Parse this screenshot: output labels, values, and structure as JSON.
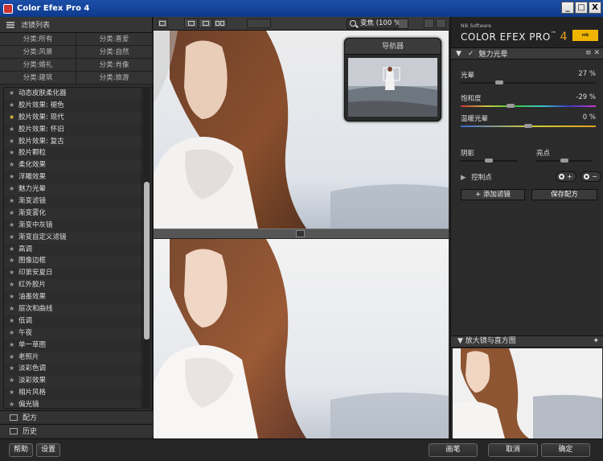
{
  "window": {
    "title": "Color Efex Pro 4",
    "minimize_glyph": "_",
    "maximize_glyph": "□",
    "close_glyph": "X"
  },
  "left_panel": {
    "header": "滤镜列表",
    "categories": [
      "分类:所有",
      "分类:喜爱",
      "分类:风景",
      "分类:自然",
      "分类:婚礼",
      "分类:肖像",
      "分类:建筑",
      "分类:旅游"
    ],
    "filters": [
      {
        "label": "动态皮肤柔化器",
        "favorite": false
      },
      {
        "label": "胶片效果: 褪色",
        "favorite": false
      },
      {
        "label": "胶片效果: 现代",
        "favorite": true
      },
      {
        "label": "胶片效果: 怀旧",
        "favorite": false
      },
      {
        "label": "胶片效果: 复古",
        "favorite": false
      },
      {
        "label": "胶片颗粒",
        "favorite": false
      },
      {
        "label": "柔化效果",
        "favorite": false
      },
      {
        "label": "浮雕效果",
        "favorite": false
      },
      {
        "label": "魅力光晕",
        "favorite": false
      },
      {
        "label": "渐变滤镜",
        "favorite": false
      },
      {
        "label": "渐变雾化",
        "favorite": false
      },
      {
        "label": "渐变中灰镜",
        "favorite": false
      },
      {
        "label": "渐变自定义滤镜",
        "favorite": false
      },
      {
        "label": "高调",
        "favorite": false
      },
      {
        "label": "图像边框",
        "favorite": false
      },
      {
        "label": "印第安夏日",
        "favorite": false
      },
      {
        "label": "红外胶片",
        "favorite": false
      },
      {
        "label": "油墨效果",
        "favorite": false
      },
      {
        "label": "层次和曲线",
        "favorite": false
      },
      {
        "label": "低调",
        "favorite": false
      },
      {
        "label": "午夜",
        "favorite": false
      },
      {
        "label": "单一草图",
        "favorite": false
      },
      {
        "label": "老照片",
        "favorite": false
      },
      {
        "label": "淡彩色调",
        "favorite": false
      },
      {
        "label": "淡彩效果",
        "favorite": false
      },
      {
        "label": "相片风格",
        "favorite": false
      },
      {
        "label": "偏光镜",
        "favorite": false
      }
    ],
    "star_glyph": "★",
    "recipes_label": "配方",
    "history_label": "历史"
  },
  "toolbar": {
    "zoom_label": "变焦 (100 %)"
  },
  "navigator": {
    "title": "导航器"
  },
  "right_panel": {
    "brand_small": "Nik Software",
    "brand_name": "COLOR EFEX PRO",
    "brand_tm": "™",
    "brand_version": "4",
    "brand_logo": "nik software",
    "filter_title": "魅力光晕",
    "filter_controls": "≡ ✕",
    "sliders": [
      {
        "label": "光晕",
        "value": "27",
        "unit": "%",
        "fraction": 0.27
      },
      {
        "label": "饱和度",
        "value": "-29",
        "unit": "%",
        "fraction": 0.36
      },
      {
        "label": "温暖光晕",
        "value": "0",
        "unit": "%",
        "fraction": 0.5
      }
    ],
    "shadows_label": "阴影",
    "highlights_label": "亮点",
    "shadows_fraction": 0.5,
    "highlights_fraction": 0.5,
    "control_points_label": "控制点",
    "add_filter_label": "+ 添加滤镜",
    "save_recipe_label": "保存配方",
    "loupe_title": "放大镜与直方图"
  },
  "bottom": {
    "help": "帮助",
    "settings": "设置",
    "brush": "画笔",
    "cancel": "取消",
    "ok": "确定"
  },
  "colors": {
    "accent": "#e8a020",
    "favorite_star": "#e8c33a",
    "titlebar": "#1c4fa8"
  }
}
